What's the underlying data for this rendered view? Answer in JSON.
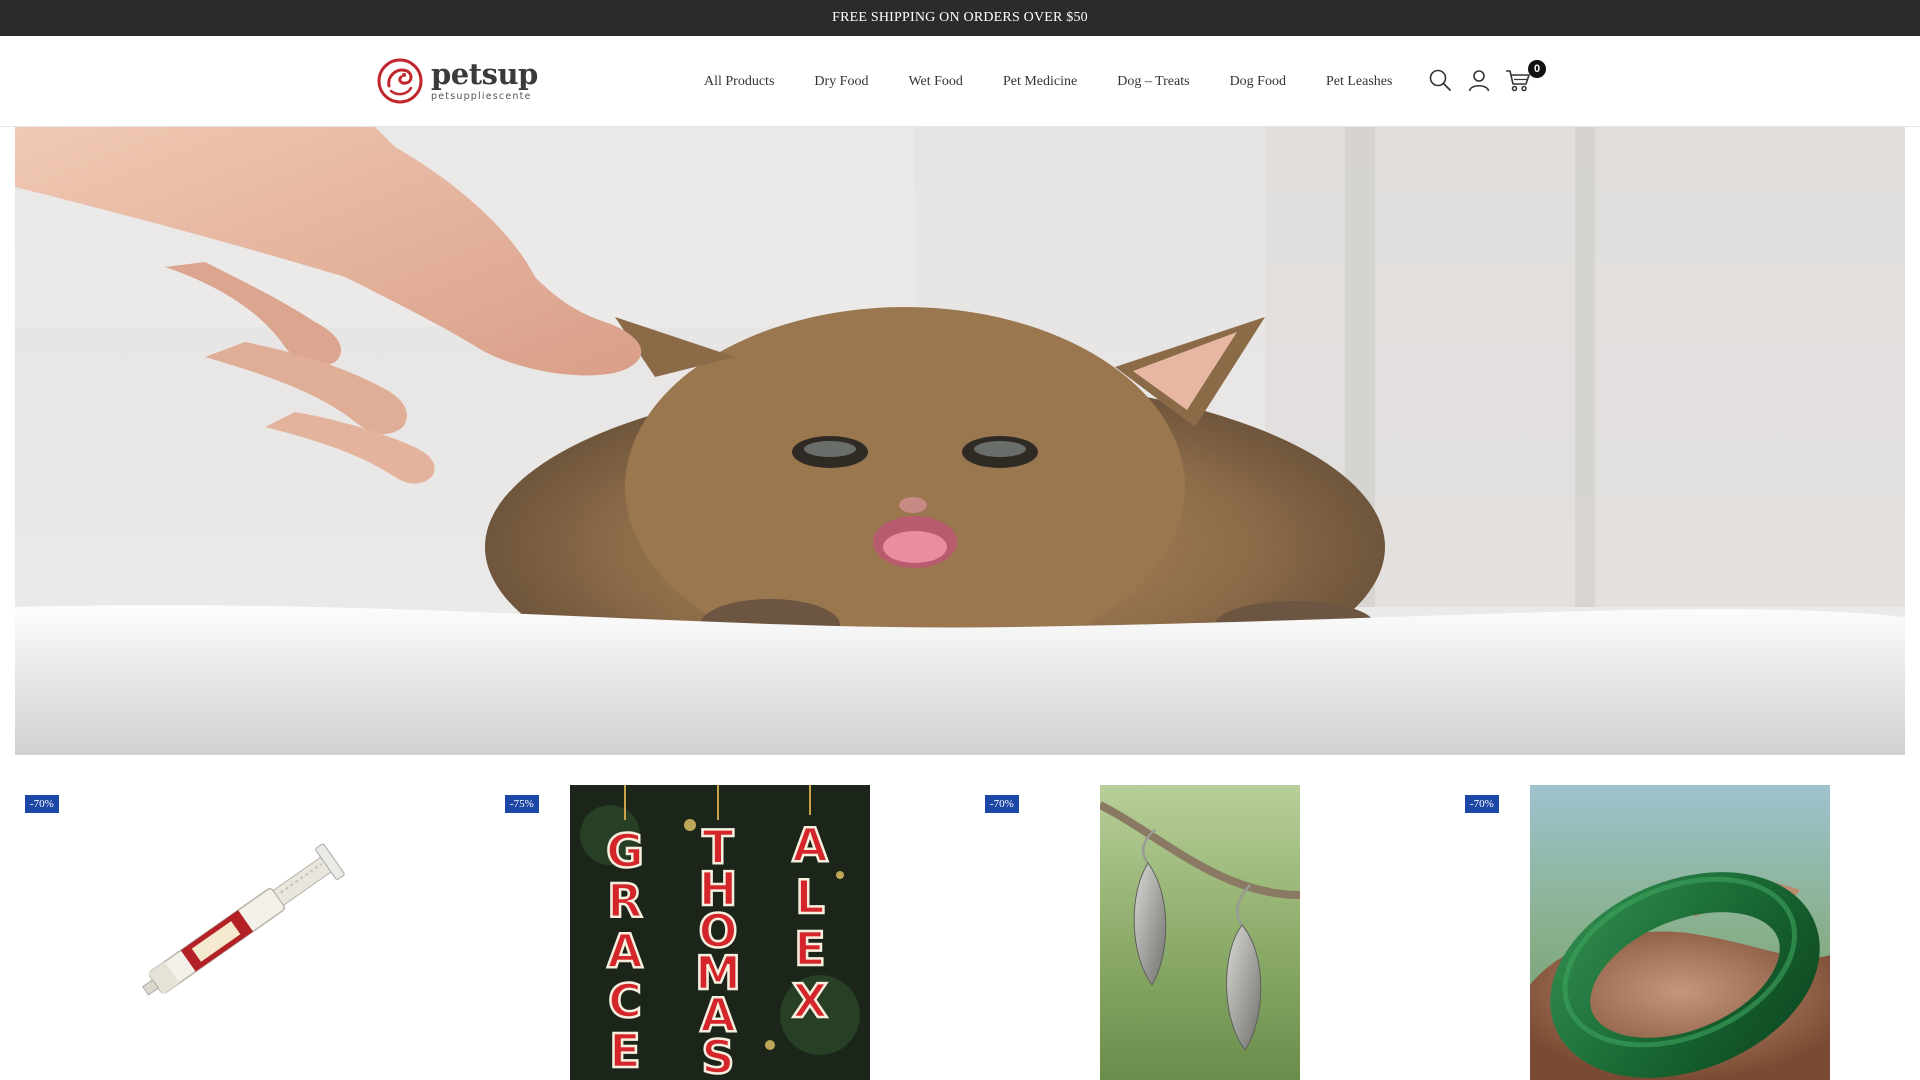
{
  "announcement": "FREE SHIPPING ON ORDERS OVER $50",
  "logo": {
    "name": "petsup",
    "tagline": "petsuppliescente"
  },
  "nav": {
    "items": [
      {
        "label": "All Products"
      },
      {
        "label": "Dry Food"
      },
      {
        "label": "Wet Food"
      },
      {
        "label": "Pet Medicine"
      },
      {
        "label": "Dog – Treats"
      },
      {
        "label": "Dog Food"
      },
      {
        "label": "Pet Leashes"
      }
    ]
  },
  "header_icons": {
    "search": "search-icon",
    "account": "user-icon",
    "cart": "cart-icon",
    "cart_count": "0"
  },
  "hero": {
    "image": "kitten-with-hand-photo"
  },
  "products": [
    {
      "badge": "-70%",
      "image": "oral-paste-syringe"
    },
    {
      "badge": "-75%",
      "image": "name-ornaments-grace-thomas-alex"
    },
    {
      "badge": "-70%",
      "image": "silver-leaf-earrings"
    },
    {
      "badge": "-70%",
      "image": "green-cuff-bracelet"
    }
  ],
  "ornament_letters": [
    "GRACE",
    "THOMAS",
    "ALEX"
  ],
  "colors": {
    "topbar": "#2b2b2b",
    "badge": "#1d47a6",
    "logo_red": "#c0272d"
  }
}
